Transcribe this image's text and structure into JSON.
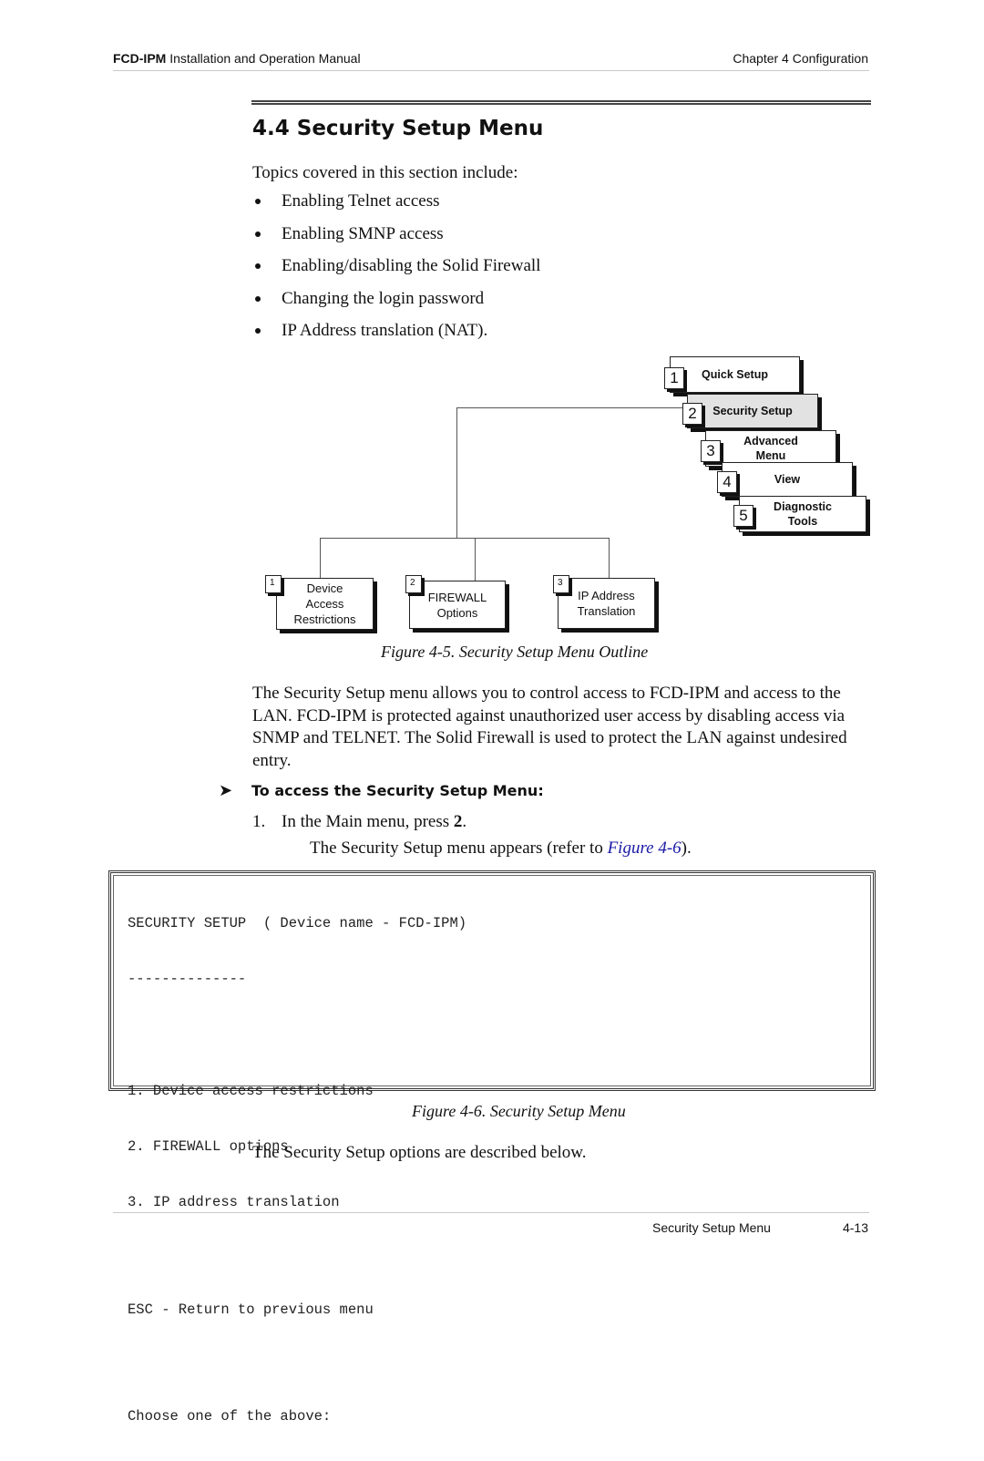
{
  "header": {
    "product": "FCD-IPM",
    "manual_title": " Installation and Operation Manual",
    "chapter": "Chapter 4  Configuration"
  },
  "section": {
    "title": "4.4  Security Setup Menu",
    "intro": "Topics covered in this section include:",
    "topics": [
      "Enabling Telnet access",
      "Enabling SMNP access",
      "Enabling/disabling the Solid Firewall",
      "Changing the login password",
      "IP Address translation (NAT)."
    ]
  },
  "diagram": {
    "main_menu": [
      {
        "num": "1",
        "label": "Quick Setup",
        "active": false
      },
      {
        "num": "2",
        "label": "Security Setup",
        "active": true
      },
      {
        "num": "3",
        "label": "Advanced\nMenu",
        "active": false
      },
      {
        "num": "4",
        "label": "View",
        "active": false
      },
      {
        "num": "5",
        "label": "Diagnostic\nTools",
        "active": false
      }
    ],
    "submenu": [
      {
        "num": "1",
        "label": "Device\nAccess\nRestrictions"
      },
      {
        "num": "2",
        "label": "FIREWALL\nOptions"
      },
      {
        "num": "3",
        "label": "IP Address\nTranslation"
      }
    ],
    "caption": "Figure 4-5.  Security Setup Menu Outline"
  },
  "description": "The Security Setup menu allows you to control access to FCD-IPM and access to the LAN. FCD-IPM is protected against unauthorized user access by disabling access via SNMP and TELNET. The Solid Firewall is used to protect the LAN against undesired entry.",
  "procedure": {
    "arrow_icon": "➤",
    "heading": "To access the Security Setup Menu:",
    "step_num": "1.",
    "step_text_pre": "In the Main menu, press ",
    "step_key": "2",
    "step_text_post": ".",
    "result_pre": "The Security Setup menu appears (refer to ",
    "result_link": "Figure 4-6",
    "result_post": ")."
  },
  "terminal": {
    "lines": [
      "SECURITY SETUP  ( Device name - FCD-IPM)",
      "--------------",
      "",
      "1. Device access restrictions",
      "2. FIREWALL options",
      "3. IP address translation",
      "",
      "ESC - Return to previous menu",
      "",
      "Choose one of the above:"
    ],
    "caption": "Figure 4-6.  Security Setup Menu"
  },
  "closing": "The Security Setup options are described below.",
  "footer": {
    "section": "Security Setup Menu",
    "page": "4-13"
  }
}
